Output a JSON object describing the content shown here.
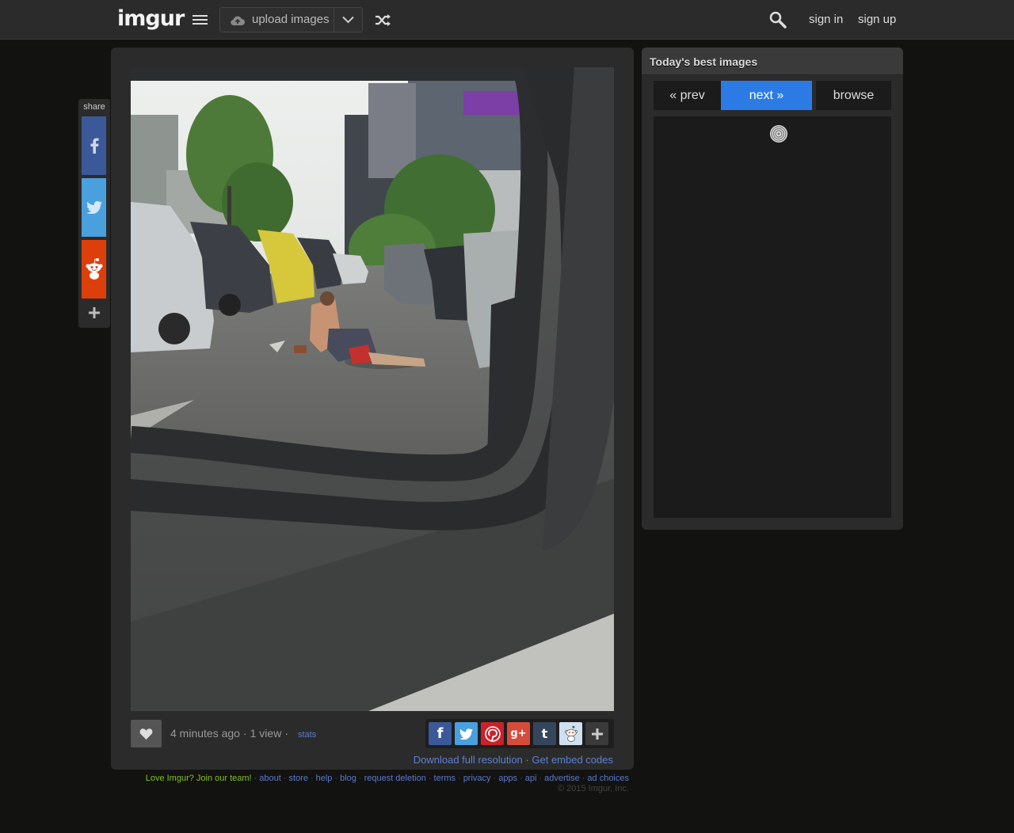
{
  "topbar": {
    "logo": "imgur",
    "upload_label": "upload images",
    "signin_label": "sign in",
    "signup_label": "sign up"
  },
  "share_bar": {
    "label": "share"
  },
  "post": {
    "time_ago": "4 minutes ago",
    "views": "1 view",
    "stats_label": "stats",
    "download_label": "Download full resolution",
    "embed_label": "Get embed codes"
  },
  "social_icons": [
    "facebook-icon",
    "twitter-icon",
    "pinterest-icon",
    "google-plus-icon",
    "tumblr-icon",
    "reddit-icon",
    "more-icon"
  ],
  "sidebar": {
    "title": "Today's best images",
    "prev_label": "« prev",
    "next_label": "next »",
    "browse_label": "browse"
  },
  "footer": {
    "love_label": "Love Imgur? Join our team!",
    "links": [
      "about",
      "store",
      "help",
      "blog",
      "request deletion",
      "terms",
      "privacy",
      "apps",
      "api",
      "advertise",
      "ad choices"
    ],
    "copyright": "© 2015 Imgur, Inc."
  },
  "colors": {
    "accent_blue": "#2c7be5",
    "link_blue": "#5b7ac9",
    "love_green": "#85bf25",
    "background": "#121211",
    "panel": "#2b2b2b"
  }
}
